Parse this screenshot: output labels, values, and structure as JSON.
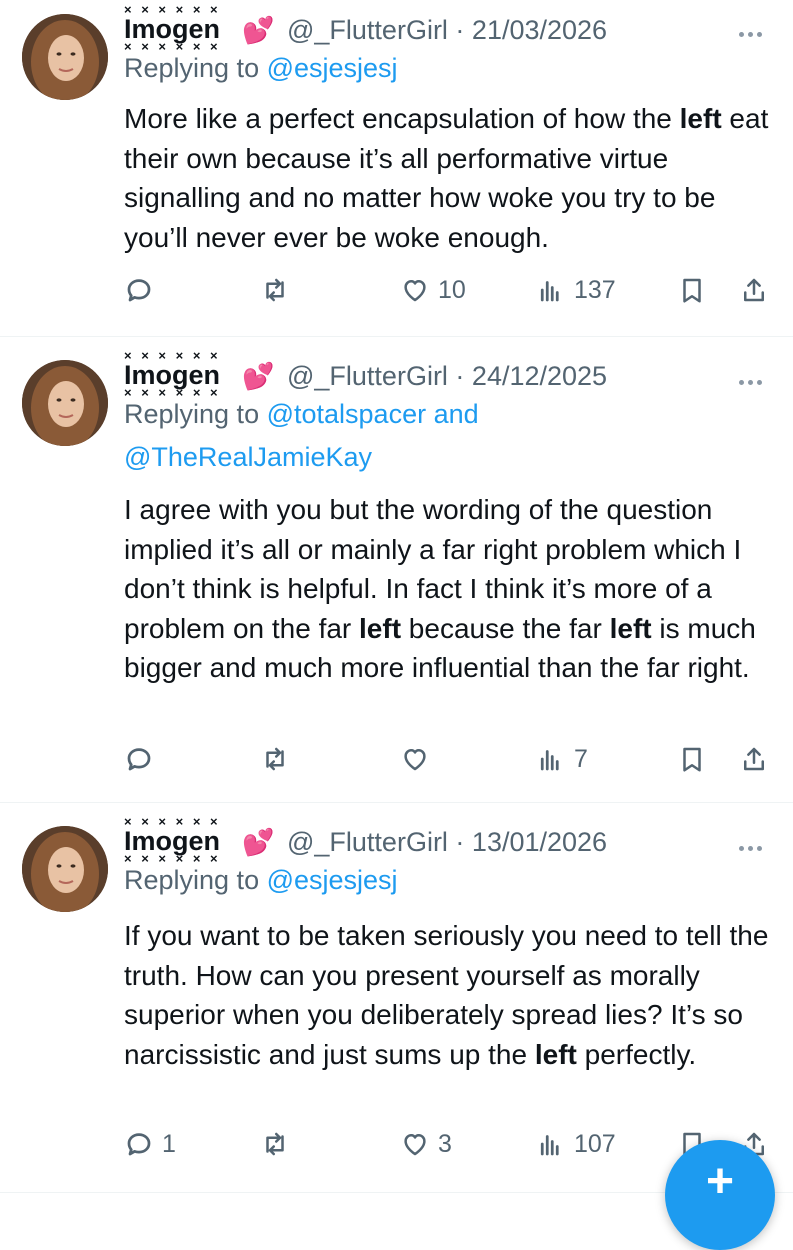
{
  "tweets": [
    {
      "display_name": "Imogen",
      "name_decor_top": "× × × × × ×",
      "name_decor_bottom": "× × × × × ×",
      "emoji": "💕",
      "handle_date": "@_FlutterGirl · 21/03/2026",
      "replying_prefix": "Replying to ",
      "replying_to": "@esjesjesj",
      "replying_to_2": "",
      "body": [
        {
          "text": "More like a perfect encapsulation of how the ",
          "bold": false
        },
        {
          "text": "left",
          "bold": true
        },
        {
          "text": " eat their own because it’s all performative virtue signalling and no matter how woke you try to be you’ll never ever be woke enough.",
          "bold": false
        }
      ],
      "replies": "",
      "retweets": "",
      "likes": "10",
      "views": "137"
    },
    {
      "display_name": "Imogen",
      "name_decor_top": "× × × × × ×",
      "name_decor_bottom": "× × × × × ×",
      "emoji": "💕",
      "handle_date": "@_FlutterGirl · 24/12/2025",
      "replying_prefix": "Replying to ",
      "replying_to": "@totalspacer and",
      "replying_to_2": "@TheRealJamieKay",
      "body": [
        {
          "text": "I agree with you but the wording of the question implied it’s all or mainly a far right problem which I don’t think is helpful. In fact I think it’s more of a problem on the far ",
          "bold": false
        },
        {
          "text": "left",
          "bold": true
        },
        {
          "text": " because the far ",
          "bold": false
        },
        {
          "text": "left",
          "bold": true
        },
        {
          "text": " is much bigger and much more influential than the far right.",
          "bold": false
        }
      ],
      "replies": "",
      "retweets": "",
      "likes": "",
      "views": "7"
    },
    {
      "display_name": "Imogen",
      "name_decor_top": "× × × × × ×",
      "name_decor_bottom": "× × × × × ×",
      "emoji": "💕",
      "handle_date": "@_FlutterGirl · 13/01/2026",
      "replying_prefix": "Replying to ",
      "replying_to": "@esjesjesj",
      "replying_to_2": "",
      "body": [
        {
          "text": "If you want to be taken seriously you need to tell the truth. How can you present yourself as morally superior when you deliberately spread lies? It’s so narcissistic and just sums up the ",
          "bold": false
        },
        {
          "text": "left",
          "bold": true
        },
        {
          "text": " perfectly.",
          "bold": false
        }
      ],
      "replies": "1",
      "retweets": "",
      "likes": "3",
      "views": "107"
    }
  ],
  "fab_symbol": "+",
  "colors": {
    "accent": "#1d9bf0",
    "text": "#0f1419",
    "muted": "#536471",
    "divider": "#eff3f4",
    "heart_emoji": "#e4358f"
  },
  "icons": [
    "reply-icon",
    "retweet-icon",
    "like-icon",
    "views-icon",
    "bookmark-icon",
    "share-icon",
    "more-icon",
    "compose-plus-icon"
  ]
}
